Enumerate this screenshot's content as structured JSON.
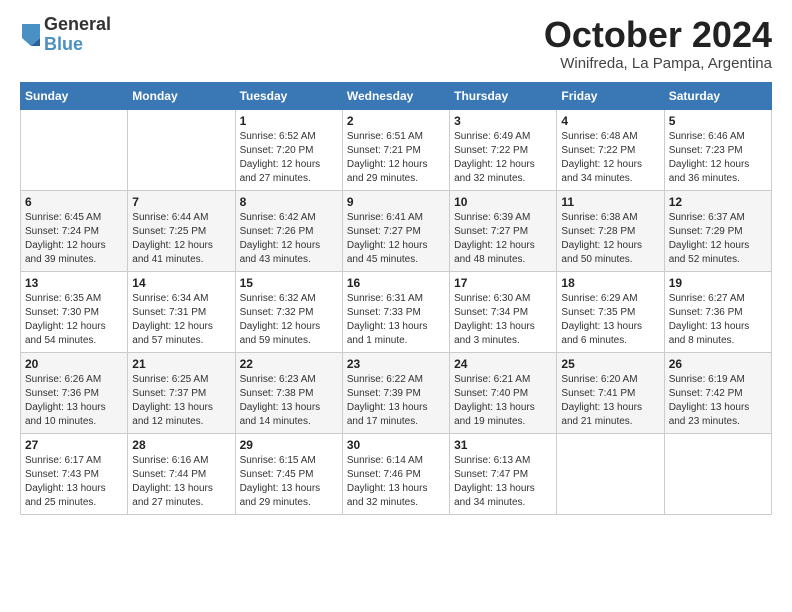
{
  "header": {
    "logo_line1": "General",
    "logo_line2": "Blue",
    "month": "October 2024",
    "location": "Winifreda, La Pampa, Argentina"
  },
  "days_of_week": [
    "Sunday",
    "Monday",
    "Tuesday",
    "Wednesday",
    "Thursday",
    "Friday",
    "Saturday"
  ],
  "weeks": [
    [
      {
        "day": "",
        "info": ""
      },
      {
        "day": "",
        "info": ""
      },
      {
        "day": "1",
        "info": "Sunrise: 6:52 AM\nSunset: 7:20 PM\nDaylight: 12 hours\nand 27 minutes."
      },
      {
        "day": "2",
        "info": "Sunrise: 6:51 AM\nSunset: 7:21 PM\nDaylight: 12 hours\nand 29 minutes."
      },
      {
        "day": "3",
        "info": "Sunrise: 6:49 AM\nSunset: 7:22 PM\nDaylight: 12 hours\nand 32 minutes."
      },
      {
        "day": "4",
        "info": "Sunrise: 6:48 AM\nSunset: 7:22 PM\nDaylight: 12 hours\nand 34 minutes."
      },
      {
        "day": "5",
        "info": "Sunrise: 6:46 AM\nSunset: 7:23 PM\nDaylight: 12 hours\nand 36 minutes."
      }
    ],
    [
      {
        "day": "6",
        "info": "Sunrise: 6:45 AM\nSunset: 7:24 PM\nDaylight: 12 hours\nand 39 minutes."
      },
      {
        "day": "7",
        "info": "Sunrise: 6:44 AM\nSunset: 7:25 PM\nDaylight: 12 hours\nand 41 minutes."
      },
      {
        "day": "8",
        "info": "Sunrise: 6:42 AM\nSunset: 7:26 PM\nDaylight: 12 hours\nand 43 minutes."
      },
      {
        "day": "9",
        "info": "Sunrise: 6:41 AM\nSunset: 7:27 PM\nDaylight: 12 hours\nand 45 minutes."
      },
      {
        "day": "10",
        "info": "Sunrise: 6:39 AM\nSunset: 7:27 PM\nDaylight: 12 hours\nand 48 minutes."
      },
      {
        "day": "11",
        "info": "Sunrise: 6:38 AM\nSunset: 7:28 PM\nDaylight: 12 hours\nand 50 minutes."
      },
      {
        "day": "12",
        "info": "Sunrise: 6:37 AM\nSunset: 7:29 PM\nDaylight: 12 hours\nand 52 minutes."
      }
    ],
    [
      {
        "day": "13",
        "info": "Sunrise: 6:35 AM\nSunset: 7:30 PM\nDaylight: 12 hours\nand 54 minutes."
      },
      {
        "day": "14",
        "info": "Sunrise: 6:34 AM\nSunset: 7:31 PM\nDaylight: 12 hours\nand 57 minutes."
      },
      {
        "day": "15",
        "info": "Sunrise: 6:32 AM\nSunset: 7:32 PM\nDaylight: 12 hours\nand 59 minutes."
      },
      {
        "day": "16",
        "info": "Sunrise: 6:31 AM\nSunset: 7:33 PM\nDaylight: 13 hours\nand 1 minute."
      },
      {
        "day": "17",
        "info": "Sunrise: 6:30 AM\nSunset: 7:34 PM\nDaylight: 13 hours\nand 3 minutes."
      },
      {
        "day": "18",
        "info": "Sunrise: 6:29 AM\nSunset: 7:35 PM\nDaylight: 13 hours\nand 6 minutes."
      },
      {
        "day": "19",
        "info": "Sunrise: 6:27 AM\nSunset: 7:36 PM\nDaylight: 13 hours\nand 8 minutes."
      }
    ],
    [
      {
        "day": "20",
        "info": "Sunrise: 6:26 AM\nSunset: 7:36 PM\nDaylight: 13 hours\nand 10 minutes."
      },
      {
        "day": "21",
        "info": "Sunrise: 6:25 AM\nSunset: 7:37 PM\nDaylight: 13 hours\nand 12 minutes."
      },
      {
        "day": "22",
        "info": "Sunrise: 6:23 AM\nSunset: 7:38 PM\nDaylight: 13 hours\nand 14 minutes."
      },
      {
        "day": "23",
        "info": "Sunrise: 6:22 AM\nSunset: 7:39 PM\nDaylight: 13 hours\nand 17 minutes."
      },
      {
        "day": "24",
        "info": "Sunrise: 6:21 AM\nSunset: 7:40 PM\nDaylight: 13 hours\nand 19 minutes."
      },
      {
        "day": "25",
        "info": "Sunrise: 6:20 AM\nSunset: 7:41 PM\nDaylight: 13 hours\nand 21 minutes."
      },
      {
        "day": "26",
        "info": "Sunrise: 6:19 AM\nSunset: 7:42 PM\nDaylight: 13 hours\nand 23 minutes."
      }
    ],
    [
      {
        "day": "27",
        "info": "Sunrise: 6:17 AM\nSunset: 7:43 PM\nDaylight: 13 hours\nand 25 minutes."
      },
      {
        "day": "28",
        "info": "Sunrise: 6:16 AM\nSunset: 7:44 PM\nDaylight: 13 hours\nand 27 minutes."
      },
      {
        "day": "29",
        "info": "Sunrise: 6:15 AM\nSunset: 7:45 PM\nDaylight: 13 hours\nand 29 minutes."
      },
      {
        "day": "30",
        "info": "Sunrise: 6:14 AM\nSunset: 7:46 PM\nDaylight: 13 hours\nand 32 minutes."
      },
      {
        "day": "31",
        "info": "Sunrise: 6:13 AM\nSunset: 7:47 PM\nDaylight: 13 hours\nand 34 minutes."
      },
      {
        "day": "",
        "info": ""
      },
      {
        "day": "",
        "info": ""
      }
    ]
  ]
}
